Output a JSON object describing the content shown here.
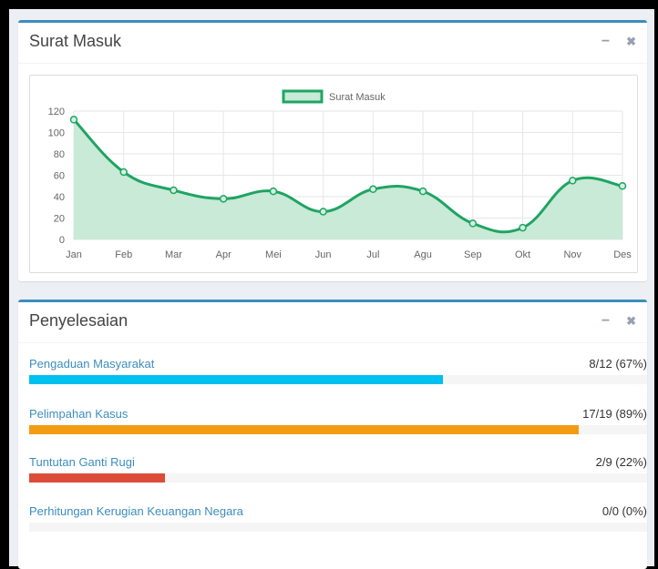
{
  "panels": {
    "surat": {
      "title": "Surat Masuk"
    },
    "penyelesaian": {
      "title": "Penyelesaian"
    }
  },
  "tools": {
    "minimize_icon": "minus-icon",
    "close_icon": "close-icon",
    "minimize_glyph": "−",
    "close_glyph": "✖"
  },
  "chart_data": {
    "type": "area",
    "legend": {
      "label": "Surat Masuk",
      "placement": "top-center"
    },
    "categories": [
      "Jan",
      "Feb",
      "Mar",
      "Apr",
      "Mei",
      "Jun",
      "Jul",
      "Agu",
      "Sep",
      "Okt",
      "Nov",
      "Des"
    ],
    "series": [
      {
        "name": "Surat Masuk",
        "values": [
          112,
          63,
          46,
          38,
          45,
          26,
          47,
          45,
          15,
          11,
          55,
          50
        ]
      }
    ],
    "yticks": [
      0,
      20,
      40,
      60,
      80,
      100,
      120
    ],
    "ylim": [
      0,
      120
    ],
    "grid": true,
    "colors": {
      "line": "#1fa463",
      "fill": "#c8ead7",
      "point": "#1fa463"
    }
  },
  "progress": [
    {
      "label": "Pengaduan Masyarakat",
      "value": "8/12 (67%)",
      "fraction": 0.67,
      "color": "#00c0ef"
    },
    {
      "label": "Pelimpahan Kasus",
      "value": "17/19 (89%)",
      "fraction": 0.89,
      "color": "#f39c12"
    },
    {
      "label": "Tuntutan Ganti Rugi",
      "value": "2/9 (22%)",
      "fraction": 0.22,
      "color": "#dd4b39"
    },
    {
      "label": "Perhitungan Kerugian Keuangan Negara",
      "value": "0/0 (0%)",
      "fraction": 0.0,
      "color": "#3c8dbc"
    }
  ]
}
